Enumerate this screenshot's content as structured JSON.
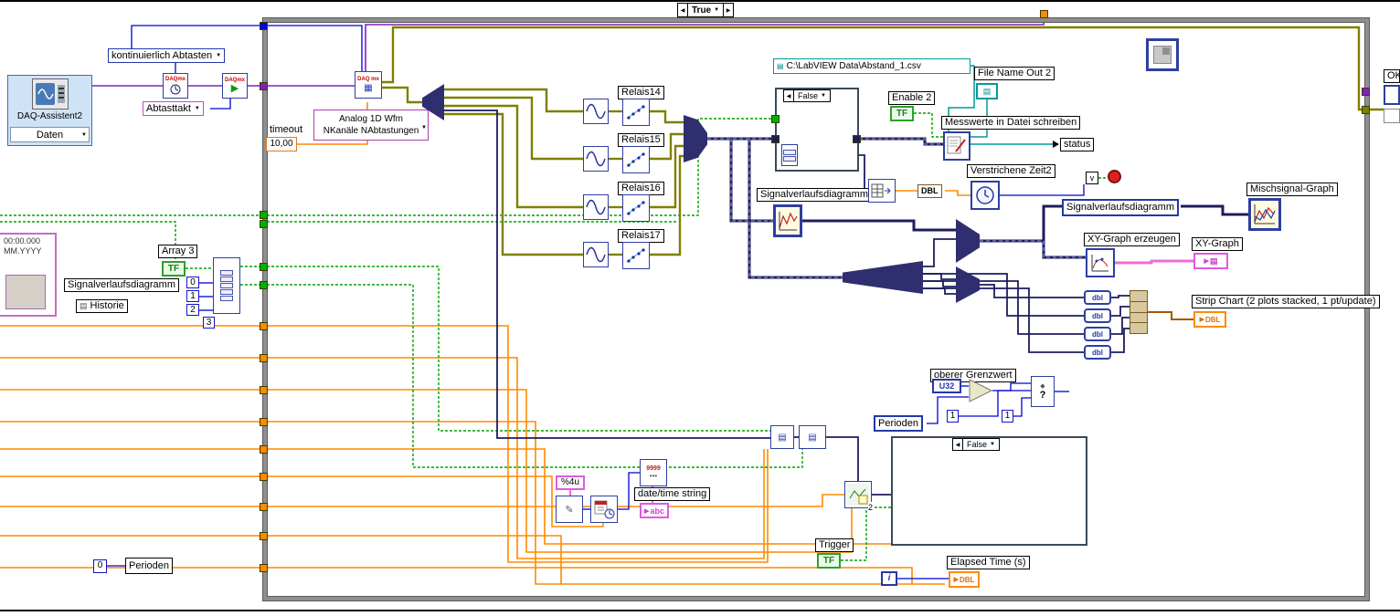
{
  "colors": {
    "accent_blue": "#2438a8",
    "wire_orange": "#ff8a00",
    "wire_green": "#00a300",
    "wire_violet": "#8020c0",
    "wire_waveform": "#7f7f00",
    "wire_dynamic": "#1d1d5e",
    "wire_pink": "#e030e0",
    "wire_teal": "#009a9a",
    "frame_gray": "#8f8f8f"
  },
  "icons": {
    "prev_arrow": "◀",
    "next_arrow": "▶",
    "dropdown": "▼",
    "grid": "▤",
    "pointer": "▶",
    "question": "?"
  },
  "top": {
    "case_value": "True"
  },
  "left": {
    "sampling_mode": "kontinuierlich Abtasten",
    "daq_title": "DAQ-Assistent2",
    "daq_output": "Daten",
    "abtasttakt": "Abtasttakt",
    "daqmx": "DAQmx",
    "daqmx_read": "DAQ mx",
    "ts_line1": "00:00.000",
    "ts_line2": "MM.YYYY",
    "chart_label": "Signalverlaufsdiagramm",
    "historie": "Historie",
    "array3": "Array 3",
    "tf": "TF",
    "idx0": "0",
    "idx1": "1",
    "idx2": "2",
    "idx3": "3",
    "perioden": "Perioden",
    "zero": "0"
  },
  "diag": {
    "timeout_label": "timeout",
    "timeout_value": "10,00",
    "poly1": "Analog 1D Wfm",
    "poly2": "NKanäle NAbtastungen",
    "relais": [
      "Relais14",
      "Relais15",
      "Relais16",
      "Relais17"
    ],
    "case_false_1": "False",
    "case_false_2": "False",
    "file_path": "C:\\LabVIEW Data\\Abstand_1.csv",
    "file_name_out": "File Name Out 2",
    "enable2": "Enable 2",
    "tf": "TF",
    "write_label": "Messwerte in Datei schreiben",
    "status": "status",
    "elapsed2": "Verstrichene Zeit2",
    "v": "v",
    "chart_label": "Signalverlaufsdiagramm",
    "dbl": "DBL",
    "chart_indicator": "Signalverlaufsdiagramm",
    "mischsignal": "Mischsignal-Graph",
    "xy_create": "XY-Graph erzeugen",
    "xy_graph": "XY-Graph",
    "strip_chart": "Strip Chart (2 plots stacked, 1 pt/update)",
    "dbl_small": "dbl",
    "grenzwert": "oberer Grenzwert",
    "u32": "U32",
    "one": "1",
    "perioden": "Perioden",
    "trigger": "Trigger",
    "elapsed_time": "Elapsed Time (s)",
    "iter": "i",
    "fmt": "%4u",
    "datetime": "date/time string",
    "abc": "abc",
    "nines": "9999",
    "two": "2",
    "ok": "OK"
  }
}
